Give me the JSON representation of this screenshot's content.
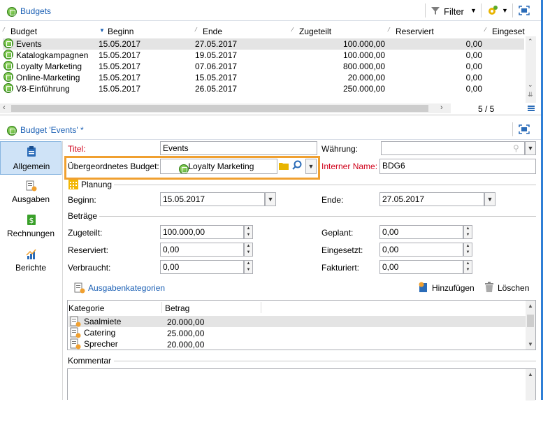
{
  "top": {
    "title": "Budgets",
    "filter_label": "Filter",
    "columns": [
      "Budget",
      "Beginn",
      "Ende",
      "Zugeteilt",
      "Reserviert",
      "Eingeset"
    ],
    "rows": [
      {
        "name": "Events",
        "beginn": "15.05.2017",
        "ende": "27.05.2017",
        "zugeteilt": "100.000,00",
        "reserviert": "0,00"
      },
      {
        "name": "Katalogkampagnen",
        "beginn": "15.05.2017",
        "ende": "19.05.2017",
        "zugeteilt": "100.000,00",
        "reserviert": "0,00"
      },
      {
        "name": "Loyalty Marketing",
        "beginn": "15.05.2017",
        "ende": "07.06.2017",
        "zugeteilt": "800.000,00",
        "reserviert": "0,00"
      },
      {
        "name": "Online-Marketing",
        "beginn": "15.05.2017",
        "ende": "15.05.2017",
        "zugeteilt": "20.000,00",
        "reserviert": "0,00"
      },
      {
        "name": "V8-Einführung",
        "beginn": "15.05.2017",
        "ende": "26.05.2017",
        "zugeteilt": "250.000,00",
        "reserviert": "0,00"
      }
    ],
    "pager": "5 / 5"
  },
  "detail": {
    "title": "Budget 'Events' *",
    "nav": [
      "Allgemein",
      "Ausgaben",
      "Rechnungen",
      "Berichte"
    ],
    "titel_label": "Titel:",
    "titel_value": "Events",
    "waehrung_label": "Währung:",
    "parent_label": "Übergeordnetes Budget:",
    "parent_value": "Loyalty Marketing",
    "internal_label": "Interner Name:",
    "internal_value": "BDG6",
    "planung_label": "Planung",
    "beginn_label": "Beginn:",
    "beginn_value": "15.05.2017",
    "ende_label": "Ende:",
    "ende_value": "27.05.2017",
    "betraege_label": "Beträge",
    "zugeteilt_label": "Zugeteilt:",
    "zugeteilt_value": "100.000,00",
    "geplant_label": "Geplant:",
    "geplant_value": "0,00",
    "reserviert_label": "Reserviert:",
    "reserviert_value": "0,00",
    "eingesetzt_label": "Eingesetzt:",
    "eingesetzt_value": "0,00",
    "verbraucht_label": "Verbraucht:",
    "verbraucht_value": "0,00",
    "fakturiert_label": "Fakturiert:",
    "fakturiert_value": "0,00",
    "kategorien_label": "Ausgabenkategorien",
    "add_label": "Hinzufügen",
    "delete_label": "Löschen",
    "cat_columns": [
      "Kategorie",
      "Betrag"
    ],
    "categories": [
      {
        "name": "Saalmiete",
        "betrag": "20.000,00"
      },
      {
        "name": "Catering",
        "betrag": "25.000,00"
      },
      {
        "name": "Sprecher",
        "betrag": "20.000,00"
      }
    ],
    "kommentar_label": "Kommentar"
  },
  "colors": {
    "accent": "#1a5fb4",
    "highlight": "#f0a030",
    "required": "#d0021b"
  }
}
